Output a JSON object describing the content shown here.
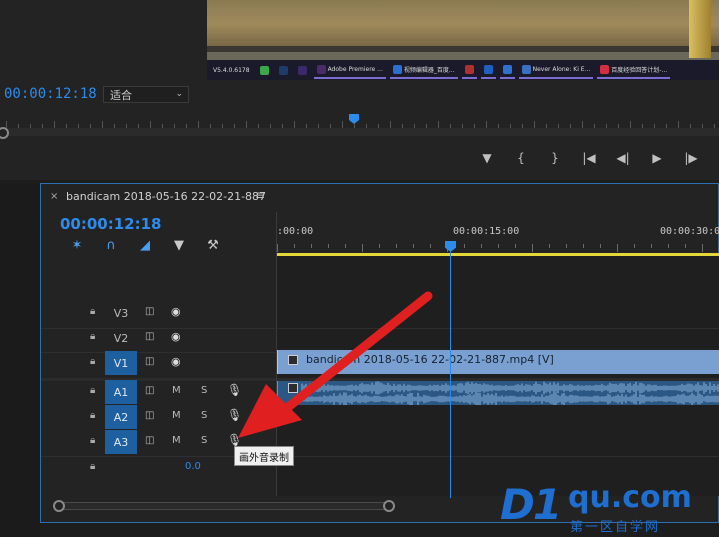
{
  "monitor": {
    "taskbar": [
      {
        "label": "V5.4.0.6178",
        "icon": "",
        "color": ""
      },
      {
        "label": "",
        "icon": "green-circle-icon",
        "color": "#3aa84a"
      },
      {
        "label": "",
        "icon": "photoshop-icon",
        "color": "#1c3c6a"
      },
      {
        "label": "",
        "icon": "after-effects-icon",
        "color": "#3a2a6a"
      },
      {
        "label": "Adobe Premiere ...",
        "icon": "premiere-icon",
        "color": "#4a2a6a"
      },
      {
        "label": "视频编辑器_百度...",
        "icon": "browser-icon",
        "color": "#2d6fd0"
      },
      {
        "label": "",
        "icon": "hand-icon",
        "color": "#b03030"
      },
      {
        "label": "",
        "icon": "q-icon",
        "color": "#2060c0"
      },
      {
        "label": "",
        "icon": "browser-icon",
        "color": "#3070d0"
      },
      {
        "label": "Never Alone: Ki E...",
        "icon": "game-icon",
        "color": "#3a70c0"
      },
      {
        "label": "百度经验回答计划-...",
        "icon": "red-circle-icon",
        "color": "#d03040"
      }
    ],
    "timecode": "00:00:12:18",
    "fit_select": "适合"
  },
  "timeline": {
    "sequence_name": "bandicam 2018-05-16 22-02-21-887",
    "timecode": "00:00:12:18",
    "ruler_labels": [
      ":00:00",
      "00:00:15:00",
      "00:00:30:00"
    ],
    "video_tracks": [
      {
        "name": "V3",
        "targeted": false
      },
      {
        "name": "V2",
        "targeted": false
      },
      {
        "name": "V1",
        "targeted": true
      }
    ],
    "audio_tracks": [
      {
        "name": "A1",
        "targeted": true
      },
      {
        "name": "A2",
        "targeted": true
      },
      {
        "name": "A3",
        "targeted": true
      }
    ],
    "mute_label": "M",
    "solo_label": "S",
    "master_volume": "0.0",
    "video_clip_label": "bandicam 2018-05-16 22-02-21-887.mp4 [V]",
    "tooltip": "画外音录制"
  },
  "watermark": {
    "brand": "D1",
    "suffix": "qu.com",
    "tagline": "第一区自学网"
  },
  "colors": {
    "accent": "#2d8ceb",
    "video_clip": "#7aa0d2",
    "audio_clip": "#2a5783",
    "work_area": "#e3d73a",
    "arrow": "#e02020"
  }
}
